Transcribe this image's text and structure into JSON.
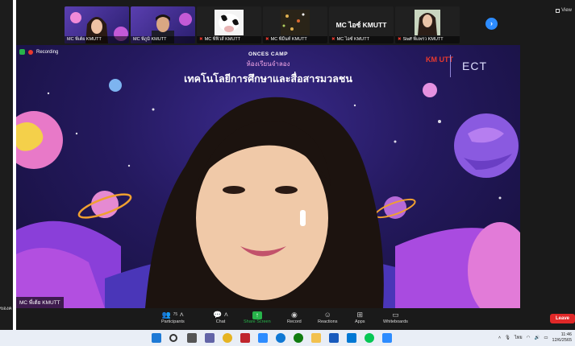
{
  "colors": {
    "accent": "#2d8cff",
    "recording": "#e8392e",
    "share": "#27b34a",
    "leave": "#e02828",
    "taskbar": "#e9eef6"
  },
  "left_window": {
    "cut_text": "ของค"
  },
  "view": {
    "label": "View",
    "icon": "grid-icon"
  },
  "thumbnails": [
    {
      "name": "MC พี่เต้ย KMUTT",
      "muted": false,
      "kind": "video"
    },
    {
      "name": "MC พี่ภูมิ KMUTT",
      "muted": false,
      "kind": "video"
    },
    {
      "name": "MC พี่ฟิวส์ KMUTT",
      "muted": true,
      "kind": "image"
    },
    {
      "name": "MC พี่มิ้นท์ KMUTT",
      "muted": true,
      "kind": "image"
    },
    {
      "name": "MC ไอซ์ KMUTT",
      "muted": true,
      "kind": "name-only",
      "display_text": "MC ไอซ์ KMUTT"
    },
    {
      "name": "Staff พี่แพรว KMUTT",
      "muted": true,
      "kind": "video"
    }
  ],
  "recording": {
    "label": "Recording"
  },
  "slide": {
    "camp": "ONCES CAMP",
    "subtitle": "ห้องเรียนจำลอง",
    "title": "เทคโนโลยีการศึกษาและสื่อสารมวลชน",
    "logo_kmutt": "KM UTT",
    "logo_ect": "ECT"
  },
  "speaker": {
    "name": "MC พี่เต้ย KMUTT"
  },
  "toolbar": {
    "participants_label": "Participants",
    "participants_count": "75",
    "chat_label": "Chat",
    "share_label": "Share Screen",
    "record_label": "Record",
    "reactions_label": "Reactions",
    "apps_label": "Apps",
    "whiteboards_label": "Whiteboards",
    "leave_label": "Leave"
  },
  "taskbar": {
    "language": "ไทย",
    "time": "11:46",
    "date": "12/6/2565"
  }
}
